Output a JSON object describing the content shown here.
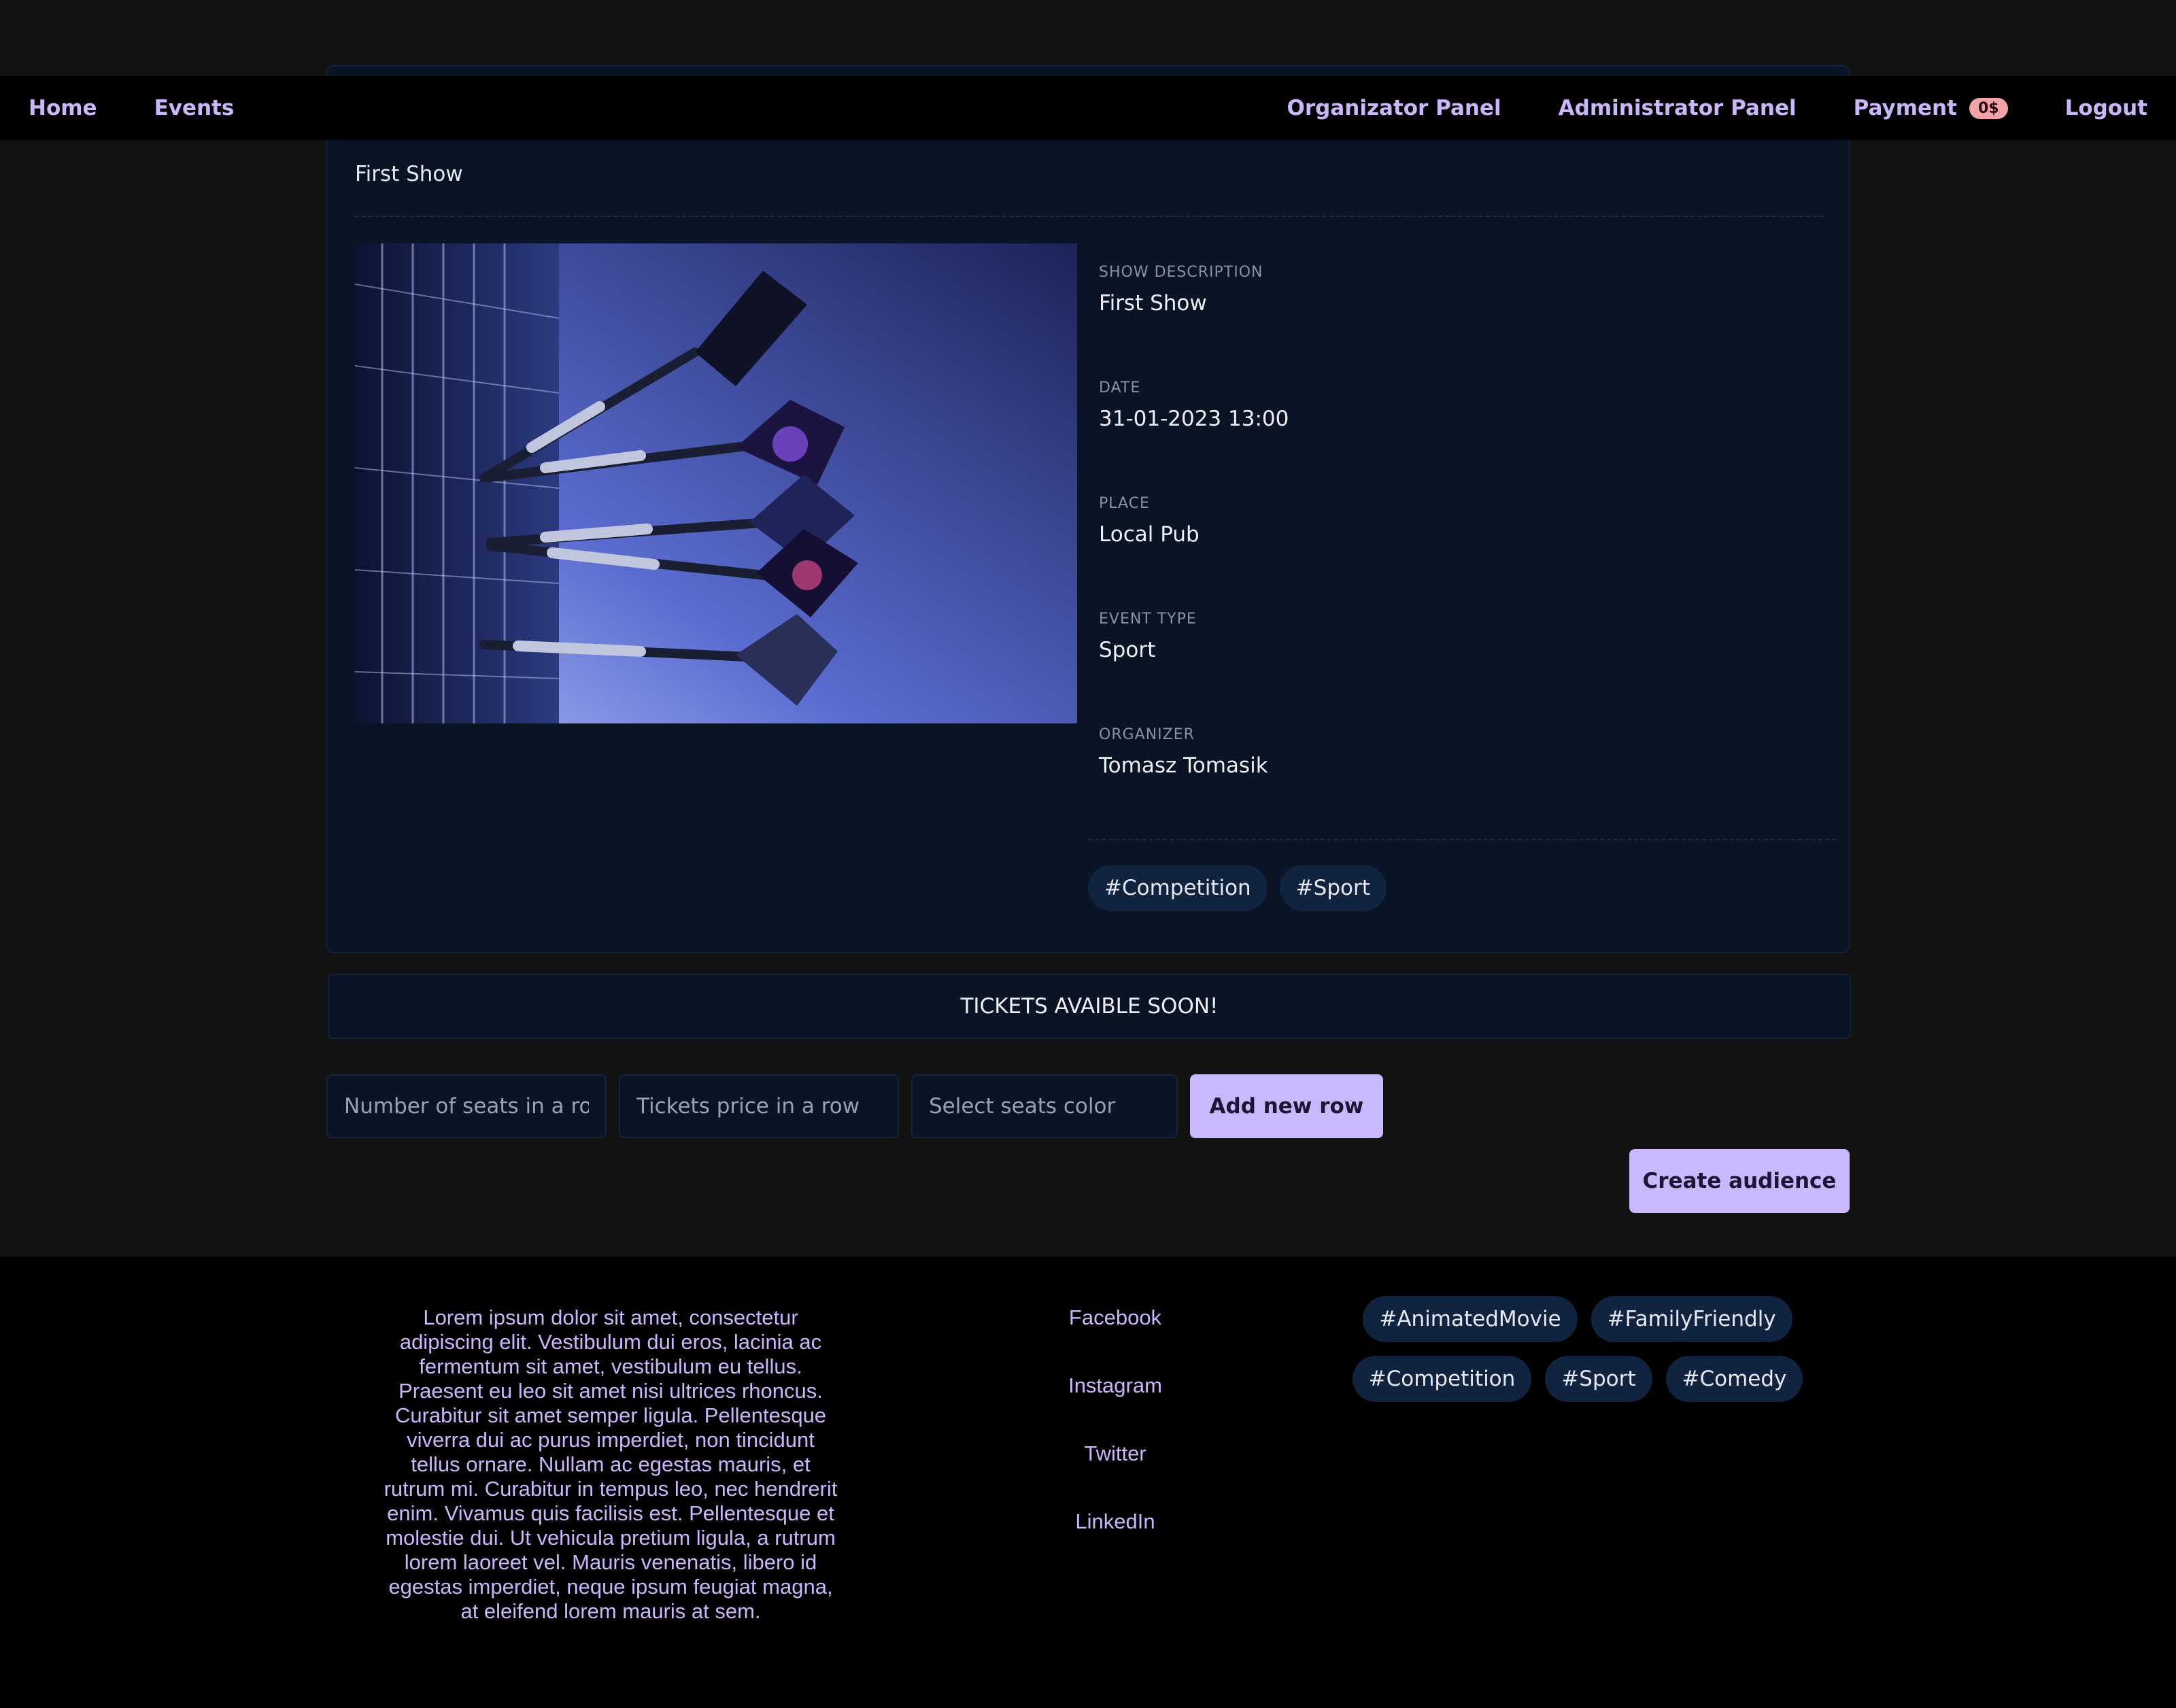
{
  "navbar": {
    "left": [
      "Home",
      "Events"
    ],
    "organizer": "Organizator Panel",
    "admin": "Administrator Panel",
    "payment": "Payment",
    "payment_badge": "0$",
    "logout": "Logout"
  },
  "event": {
    "title": "First Show",
    "image_alt": "Darts in a dartboard",
    "details": [
      {
        "label": "SHOW DESCRIPTION",
        "value": "First Show"
      },
      {
        "label": "DATE",
        "value": "31-01-2023 13:00"
      },
      {
        "label": "PLACE",
        "value": "Local Pub"
      },
      {
        "label": "EVENT TYPE",
        "value": "Sport"
      },
      {
        "label": "ORGANIZER",
        "value": "Tomasz Tomasik"
      }
    ],
    "tags": [
      "#Competition",
      "#Sport"
    ]
  },
  "tickets_banner": "TICKETS AVAIBLE SOON!",
  "form": {
    "seats_placeholder": "Number of seats in a row",
    "price_placeholder": "Tickets price in a row",
    "color_placeholder": "Select seats color",
    "add_row_label": "Add new row",
    "create_audience_label": "Create audience"
  },
  "footer": {
    "text": "Lorem ipsum dolor sit amet, consectetur adipiscing elit. Vestibulum dui eros, lacinia ac fermentum sit amet, vestibulum eu tellus. Praesent eu leo sit amet nisi ultrices rhoncus. Curabitur sit amet semper ligula. Pellentesque viverra dui ac purus imperdiet, non tincidunt tellus ornare. Nullam ac egestas mauris, et rutrum mi. Curabitur in tempus leo, nec hendrerit enim. Vivamus quis facilisis est. Pellentesque et molestie dui. Ut vehicula pretium ligula, a rutrum lorem laoreet vel. Mauris venenatis, libero id egestas imperdiet, neque ipsum feugiat magna, at eleifend lorem mauris at sem.",
    "social": [
      "Facebook",
      "Instagram",
      "Twitter",
      "LinkedIn"
    ],
    "tags_row1": [
      "#AnimatedMovie",
      "#FamilyFriendly"
    ],
    "tags_row2": [
      "#Competition",
      "#Sport",
      "#Comedy"
    ]
  },
  "colors": {
    "accent": "#c9b8fd",
    "link": "#c9b6fb",
    "card_bg": "#091425",
    "tag_bg": "#10233f",
    "page_bg": "#121212",
    "badge": "#f3a3a7"
  }
}
